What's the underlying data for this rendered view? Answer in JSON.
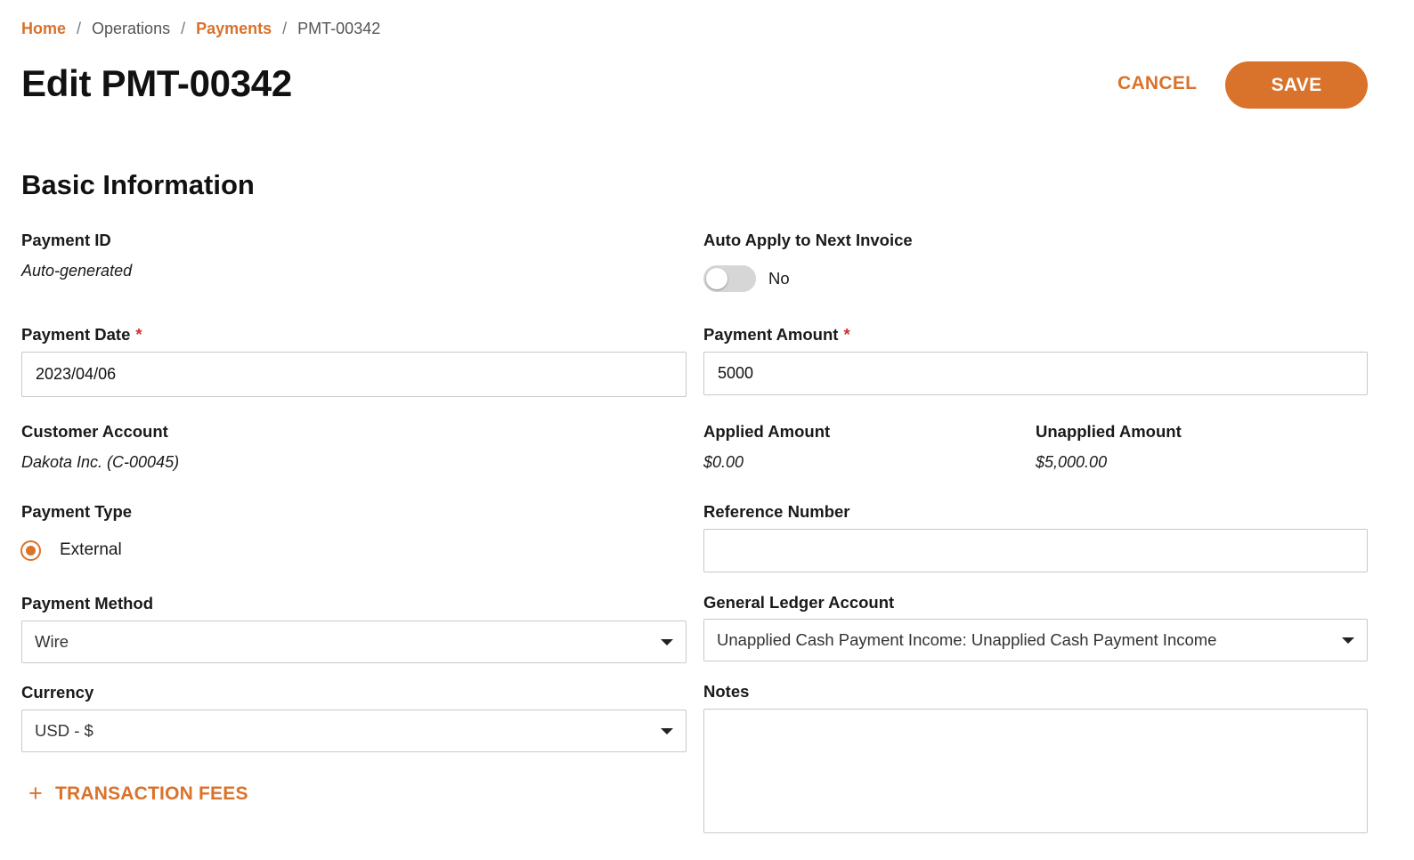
{
  "breadcrumb": {
    "home": "Home",
    "operations": "Operations",
    "payments": "Payments",
    "current": "PMT-00342",
    "separator": "/"
  },
  "header": {
    "title": "Edit PMT-00342",
    "cancel_label": "CANCEL",
    "save_label": "SAVE"
  },
  "section": {
    "title": "Basic Information"
  },
  "fields": {
    "payment_id": {
      "label": "Payment ID",
      "value": "Auto-generated"
    },
    "auto_apply": {
      "label": "Auto Apply to Next Invoice",
      "state_text": "No",
      "enabled": false
    },
    "payment_date": {
      "label": "Payment Date",
      "required_mark": "*",
      "value": "2023/04/06"
    },
    "payment_amount": {
      "label": "Payment Amount",
      "required_mark": "*",
      "value": "5000"
    },
    "customer_account": {
      "label": "Customer Account",
      "value": "Dakota Inc. (C-00045)"
    },
    "applied_amount": {
      "label": "Applied Amount",
      "value": "$0.00"
    },
    "unapplied_amount": {
      "label": "Unapplied Amount",
      "value": "$5,000.00"
    },
    "payment_type": {
      "label": "Payment Type",
      "selected": "External"
    },
    "reference_number": {
      "label": "Reference Number",
      "value": ""
    },
    "payment_method": {
      "label": "Payment Method",
      "selected": "Wire"
    },
    "gl_account": {
      "label": "General Ledger Account",
      "selected": "Unapplied Cash Payment Income: Unapplied Cash Payment Income"
    },
    "currency": {
      "label": "Currency",
      "selected": "USD - $"
    },
    "notes": {
      "label": "Notes",
      "value": ""
    }
  },
  "actions": {
    "add_transaction_fees": "TRANSACTION FEES",
    "plus_icon": "+"
  },
  "colors": {
    "accent": "#d9722b",
    "required": "#d0312d",
    "border": "#c9c9c9"
  }
}
